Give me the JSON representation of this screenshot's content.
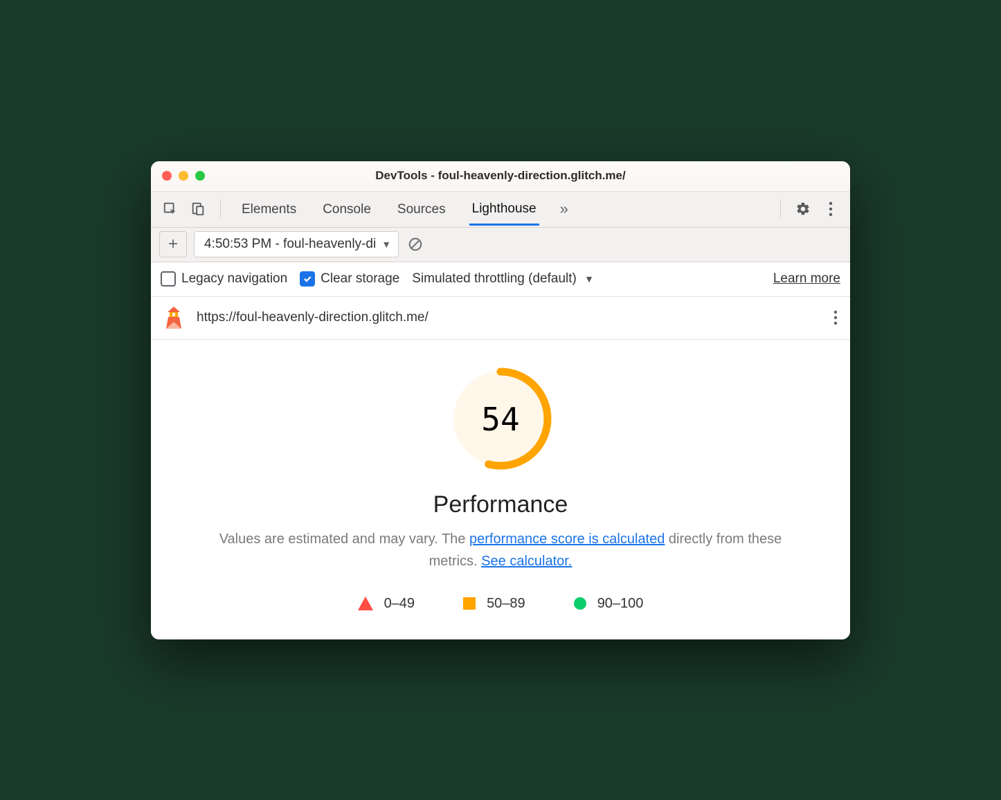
{
  "window": {
    "title": "DevTools - foul-heavenly-direction.glitch.me/"
  },
  "tabs": {
    "items": [
      "Elements",
      "Console",
      "Sources",
      "Lighthouse"
    ],
    "active": "Lighthouse"
  },
  "subbar": {
    "report_label": "4:50:53 PM - foul-heavenly-di"
  },
  "options": {
    "legacy_nav": "Legacy navigation",
    "clear_storage": "Clear storage",
    "throttling": "Simulated throttling (default)",
    "learn_more": "Learn more"
  },
  "url": "https://foul-heavenly-direction.glitch.me/",
  "score": {
    "value": "54",
    "category": "Performance",
    "percent": 54
  },
  "desc": {
    "pre": "Values are estimated and may vary. The ",
    "link1": "performance score is calculated",
    "mid": " directly from these metrics. ",
    "link2": "See calculator."
  },
  "legend": {
    "r1": "0–49",
    "r2": "50–89",
    "r3": "90–100"
  },
  "colors": {
    "average": "#ffa400",
    "average_bg": "#fff7ea",
    "fail": "#ff4e42",
    "pass": "#0cce6b"
  }
}
